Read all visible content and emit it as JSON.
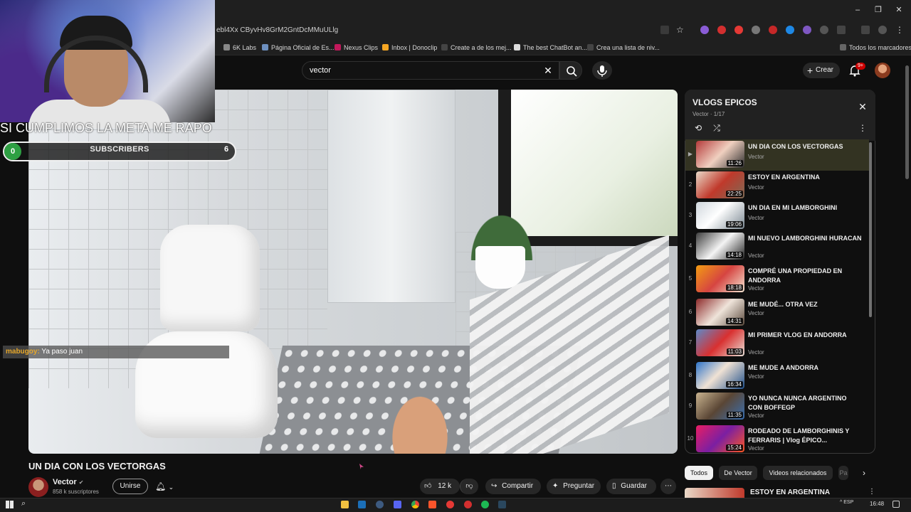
{
  "browser": {
    "url": "ebl4Xx CByvHv8GrM2GntDcMMuULlg",
    "bookmarks": [
      "6K Labs",
      "Página Oficial de Es...",
      "Nexus Clips",
      "Inbox | Donoclip",
      "Create a de los mej...",
      "The best ChatBot an...",
      "Crea una lista de niv...",
      "Todos los marcadores"
    ]
  },
  "youtube": {
    "search_value": "vector",
    "create_label": "Crear",
    "notif_badge": "9+"
  },
  "overlay": {
    "goal_text": "SI CUMPLIMOS LA META ME RAPO",
    "goal_start": "0",
    "goal_label": "SUBSCRIBERS",
    "goal_end": "6",
    "chat_user": "mabugoy:",
    "chat_msg": "Ya paso juan"
  },
  "video": {
    "title": "UN DIA CON LOS VECTORGAS",
    "channel": "Vector",
    "subscribers": "858 k suscriptores",
    "join_label": "Unirse",
    "likes": "12 k",
    "share_label": "Compartir",
    "ask_label": "Preguntar",
    "save_label": "Guardar"
  },
  "playlist": {
    "title": "VLOGS EPICOS",
    "subtitle": "Vector · 1/17",
    "items": [
      {
        "num": "",
        "title": "UN DIA CON LOS VECTORGAS",
        "channel": "Vector",
        "duration": "11:26"
      },
      {
        "num": "2",
        "title": "ESTOY EN ARGENTINA",
        "channel": "Vector",
        "duration": "22:25"
      },
      {
        "num": "3",
        "title": "UN DIA EN MI LAMBORGHINI",
        "channel": "Vector",
        "duration": "19:06"
      },
      {
        "num": "4",
        "title": "MI NUEVO LAMBORGHINI HURACAN",
        "channel": "Vector",
        "duration": "14:18"
      },
      {
        "num": "5",
        "title": "COMPRÉ UNA PROPIEDAD EN ANDORRA",
        "channel": "Vector",
        "duration": "18:18"
      },
      {
        "num": "6",
        "title": "ME MUDÉ... OTRA VEZ",
        "channel": "Vector",
        "duration": "14:31"
      },
      {
        "num": "7",
        "title": "MI PRIMER VLOG EN ANDORRA",
        "channel": "Vector",
        "duration": "11:03"
      },
      {
        "num": "8",
        "title": "ME MUDE A ANDORRA",
        "channel": "Vector",
        "duration": "16:34"
      },
      {
        "num": "9",
        "title": "YO NUNCA NUNCA ARGENTINO CON BOFFEGP",
        "channel": "Vector",
        "duration": "11:35"
      },
      {
        "num": "10",
        "title": "RODEADO DE LAMBORGHINIS Y FERRARIS | Vlog ÉPICO...",
        "channel": "Vector",
        "duration": "15:24"
      }
    ]
  },
  "chips": [
    "Todos",
    "De Vector",
    "Videos relacionados",
    "Pa"
  ],
  "next_video_title": "ESTOY EN ARGENTINA",
  "taskbar": {
    "lang": "ESP",
    "time": "16:48"
  },
  "colors": {
    "accent_red": "#cc0000",
    "goal_green": "#2ea043",
    "chat_user": "#e6a72a"
  }
}
